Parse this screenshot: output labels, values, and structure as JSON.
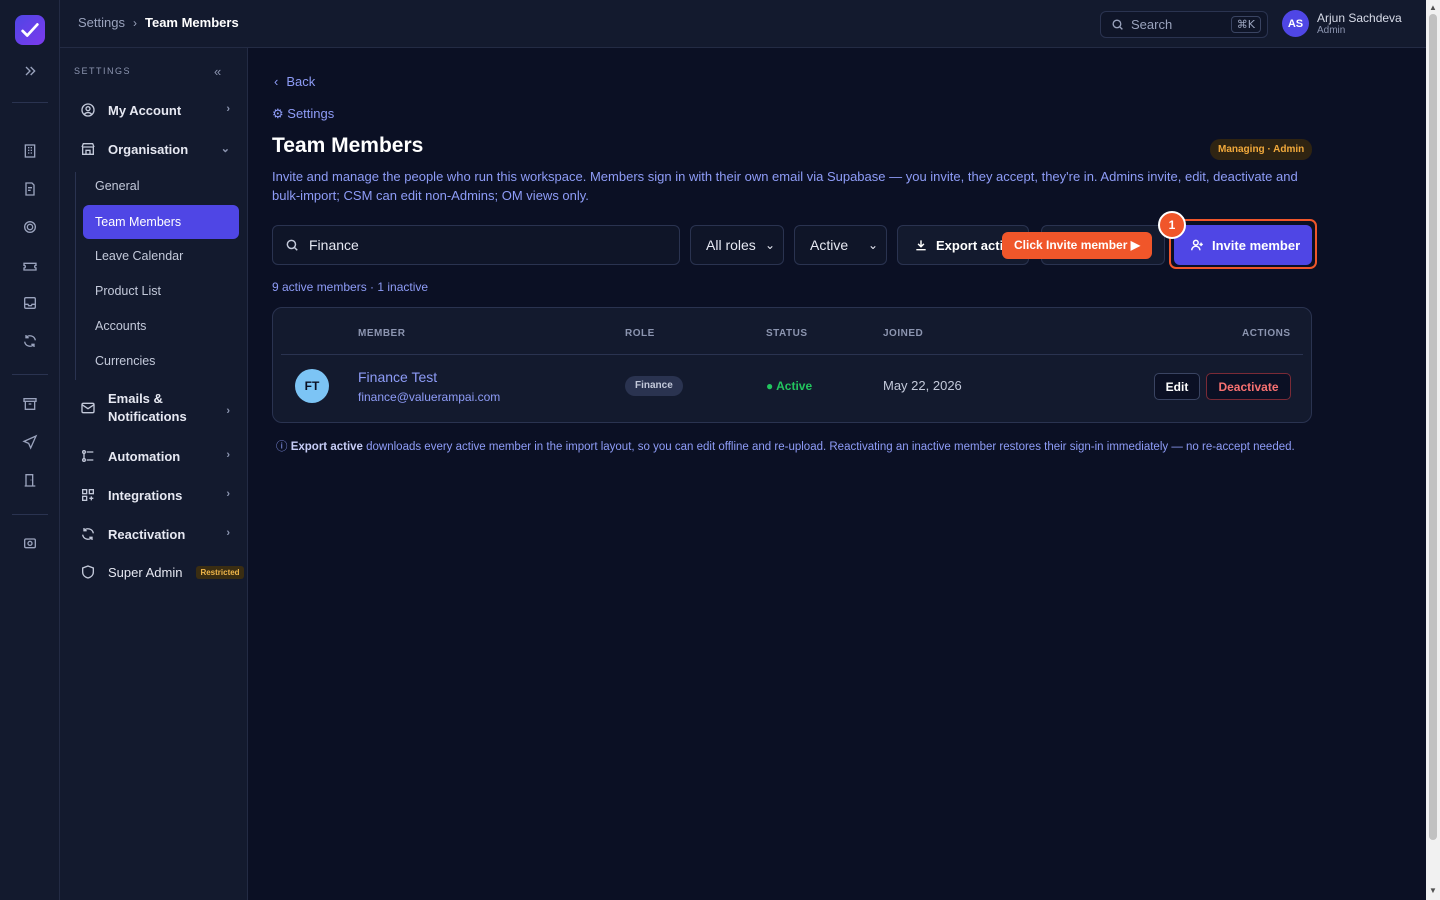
{
  "topbar": {
    "breadcrumb_root": "Settings",
    "breadcrumb_current": "Team Members",
    "search_label": "Search",
    "search_shortcut": "⌘K",
    "user_initials": "AS",
    "user_name": "Arjun Sachdeva",
    "user_role": "Admin"
  },
  "sidebar": {
    "heading": "SETTINGS",
    "items": {
      "my_account": "My Account",
      "organisation": "Organisation",
      "emails_line1": "Emails &",
      "emails_line2": "Notifications",
      "automation": "Automation",
      "integrations": "Integrations",
      "reactivation": "Reactivation",
      "super_admin": "Super Admin",
      "restricted_badge": "Restricted"
    },
    "org_sub": [
      "General",
      "Team Members",
      "Leave Calendar",
      "Product List",
      "Accounts",
      "Currencies"
    ]
  },
  "main": {
    "back": "Back",
    "settings_link": "Settings",
    "title": "Team Members",
    "managing_badge": "Managing · Admin",
    "description": "Invite and manage the people who run this workspace. Members sign in with their own email via Supabase — you invite, they accept, they're in. Admins invite, edit, deactivate and bulk-import; CSM can edit non-Admins; OM views only.",
    "search_value": "Finance",
    "role_filter": "All roles",
    "status_filter": "Active",
    "export_label": "Export active",
    "hint_label": "Click Invite member ▶",
    "step_number": "1",
    "invite_label": "Invite member",
    "counts": "9 active members · 1 inactive",
    "table": {
      "headers": {
        "member": "MEMBER",
        "role": "ROLE",
        "status": "STATUS",
        "joined": "JOINED",
        "actions": "ACTIONS"
      },
      "rows": [
        {
          "initials": "FT",
          "name": "Finance Test",
          "email": "finance@valuerampai.com",
          "role": "Finance",
          "status": "● Active",
          "joined": "May 22, 2026",
          "edit": "Edit",
          "deactivate": "Deactivate"
        }
      ]
    },
    "note_bold": "Export active",
    "note_rest": " downloads every active member in the import layout, so you can edit offline and re-upload. Reactivating an inactive member restores their sign-in immediately — no re-accept needed."
  },
  "colors": {
    "accent": "#4f46e5",
    "hint": "#f0562a",
    "active": "#22c55e",
    "danger": "#f87171",
    "link": "#8e9cf7"
  }
}
